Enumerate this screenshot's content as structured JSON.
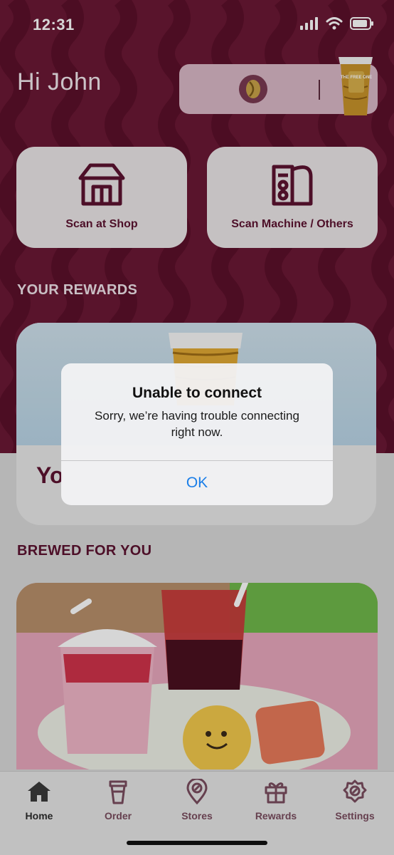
{
  "status_bar": {
    "time": "12:31"
  },
  "header": {
    "greeting": "Hi John",
    "bean_icon": "coffee-bean-icon",
    "free_cup_label": "THE FREE ONE"
  },
  "actions": [
    {
      "label": "Scan at Shop",
      "icon": "shop-icon"
    },
    {
      "label": "Scan Machine / Others",
      "icon": "machine-icon"
    }
  ],
  "rewards": {
    "section_title": "YOUR REWARDS",
    "card_text_visible": "Yo"
  },
  "brewed": {
    "section_title": "BREWED FOR YOU"
  },
  "tabs": [
    {
      "label": "Home",
      "icon": "home-icon",
      "active": true
    },
    {
      "label": "Order",
      "icon": "cup-icon",
      "active": false
    },
    {
      "label": "Stores",
      "icon": "location-pin-icon",
      "active": false
    },
    {
      "label": "Rewards",
      "icon": "gift-icon",
      "active": false
    },
    {
      "label": "Settings",
      "icon": "settings-icon",
      "active": false
    }
  ],
  "alert": {
    "title": "Unable to connect",
    "message": "Sorry, we’re having trouble connecting right now.",
    "ok_label": "OK"
  },
  "colors": {
    "brand": "#6b1835",
    "brand_text": "#5c1330",
    "ios_blue": "#1a7ee8"
  }
}
